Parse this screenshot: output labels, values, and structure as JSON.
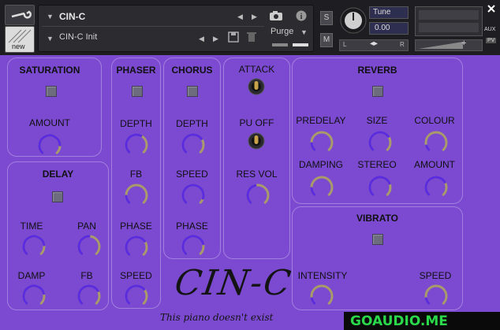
{
  "header": {
    "instrument_name": "CIN-C",
    "snapshot_name": "CIN-C Init",
    "purge_label": "Purge",
    "tune_label": "Tune",
    "tune_value": "0.00",
    "solo_label": "S",
    "mute_label": "M",
    "aux_label": "AUX",
    "pv_label": "PV",
    "new_label": "new",
    "pan_left": "L",
    "pan_right": "R"
  },
  "sections": {
    "saturation": {
      "title": "SATURATION",
      "amount": "AMOUNT"
    },
    "delay": {
      "title": "DELAY",
      "time": "TIME",
      "pan": "PAN",
      "damp": "DAMP",
      "fb": "FB"
    },
    "phaser": {
      "title": "PHASER",
      "depth": "DEPTH",
      "fb": "FB",
      "phase": "PHASE",
      "speed": "SPEED"
    },
    "chorus": {
      "title": "CHORUS",
      "depth": "DEPTH",
      "speed": "SPEED",
      "phase": "PHASE"
    },
    "switches": {
      "attack": "ATTACK",
      "pu_off": "PU OFF",
      "res_vol": "RES VOL"
    },
    "reverb": {
      "title": "REVERB",
      "predelay": "PREDELAY",
      "size": "SIZE",
      "colour": "COLOUR",
      "damping": "DAMPING",
      "stereo": "STEREO",
      "amount": "AMOUNT"
    },
    "vibrato": {
      "title": "VIBRATO",
      "intensity": "INTENSITY",
      "speed": "SPEED"
    }
  },
  "brand": {
    "logo_text": "CIN-C",
    "tagline": "This piano doesn't exist"
  },
  "watermark": "GOAUDIO.ME",
  "colors": {
    "background": "#7b4ad0",
    "knob_accent": "#5a2be0",
    "knob_track": "#a89a6a",
    "watermark": "#2ad84a"
  }
}
